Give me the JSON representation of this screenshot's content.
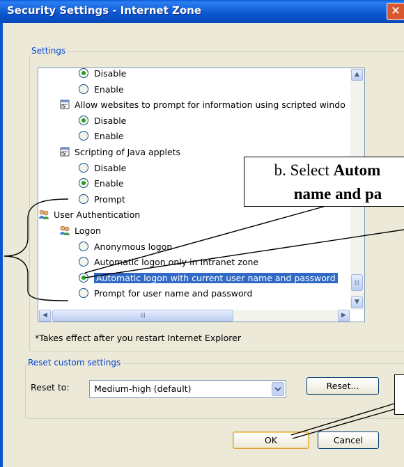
{
  "window": {
    "title": "Security Settings - Internet Zone",
    "close_glyph": "✕"
  },
  "settings_group": {
    "legend": "Settings"
  },
  "settings_list": {
    "rows": [
      {
        "kind": "radio",
        "checked": true,
        "label": "Disable"
      },
      {
        "kind": "radio",
        "checked": false,
        "label": "Enable"
      },
      {
        "kind": "setting",
        "icon": "script-settings-icon",
        "label": "Allow websites to prompt for information using scripted windo"
      },
      {
        "kind": "radio",
        "checked": true,
        "label": "Disable"
      },
      {
        "kind": "radio",
        "checked": false,
        "label": "Enable"
      },
      {
        "kind": "setting",
        "icon": "script-settings-icon",
        "label": "Scripting of Java applets"
      },
      {
        "kind": "radio",
        "checked": false,
        "label": "Disable"
      },
      {
        "kind": "radio",
        "checked": true,
        "label": "Enable"
      },
      {
        "kind": "radio",
        "checked": false,
        "label": "Prompt"
      },
      {
        "kind": "category",
        "icon": "users-icon",
        "label": "User Authentication"
      },
      {
        "kind": "subcategory",
        "icon": "users-icon",
        "label": "Logon"
      },
      {
        "kind": "radio",
        "checked": false,
        "label": "Anonymous logon"
      },
      {
        "kind": "radio",
        "checked": false,
        "label": "Automatic logon only in Intranet zone"
      },
      {
        "kind": "radio",
        "checked": true,
        "selected": true,
        "label": "Automatic logon with current user name and password"
      },
      {
        "kind": "radio",
        "checked": false,
        "label": "Prompt for user name and password"
      }
    ]
  },
  "scroll_glyphs": {
    "up": "▲",
    "down": "▼",
    "left": "◀",
    "right": "▶",
    "grip": "|||"
  },
  "footnote": "*Takes effect after you restart Internet Explorer",
  "reset_group": {
    "legend": "Reset custom settings",
    "reset_to_label": "Reset to:",
    "selected_option": "Medium-high (default)",
    "reset_button": "Reset..."
  },
  "buttons": {
    "ok": "OK",
    "cancel": "Cancel"
  },
  "annotations": {
    "callout_line1_prefix": "b. Select ",
    "callout_line1_bold": "Autom",
    "callout_line2_bold": "name and pa"
  },
  "colors": {
    "titlebar": "#0a56cf",
    "dialog_background": "#ece9d8",
    "selection": "#316ac5",
    "group_legend": "#0046d5",
    "radio_dot": "#21a121",
    "close_button": "#d9572e"
  }
}
